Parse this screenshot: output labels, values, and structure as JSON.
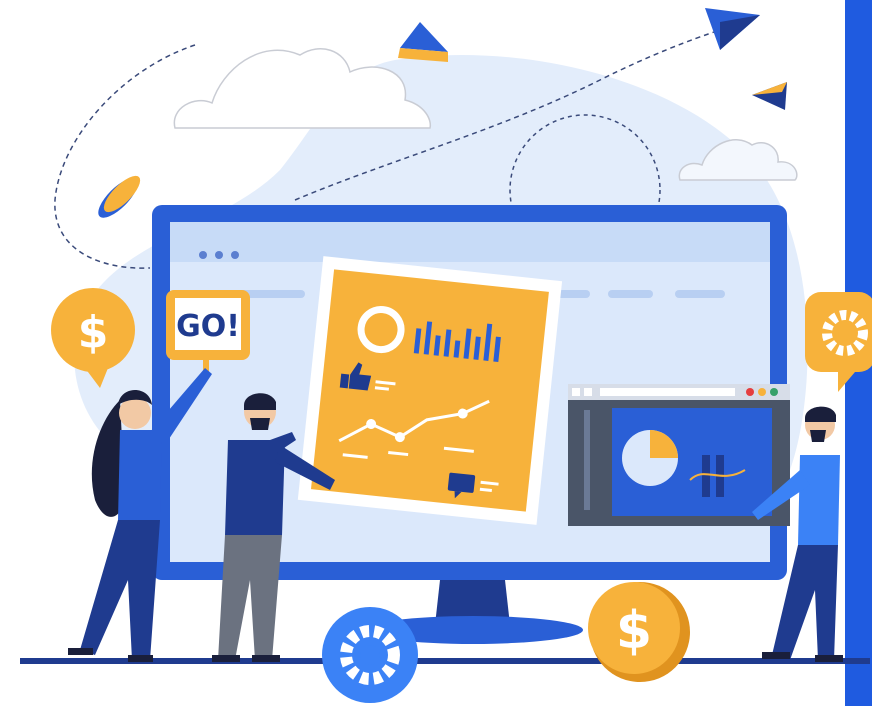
{
  "scene": {
    "description_free": true,
    "go_sign": {
      "label": "GO!"
    },
    "dollar_badge_glyph": "$",
    "icons": [
      "dollar-icon",
      "gear-icon",
      "paper-plane-icon",
      "cloud-icon",
      "thumbs-up-icon",
      "chat-icon",
      "pie-chart-icon",
      "bar-chart-icon",
      "line-chart-icon"
    ],
    "colors": {
      "brand_blue": "#2a5fd6",
      "accent_orange": "#f7b23b",
      "navy": "#1f3b8f",
      "light_blue": "#dbe8fb",
      "right_panel": "#1f5be0"
    }
  }
}
